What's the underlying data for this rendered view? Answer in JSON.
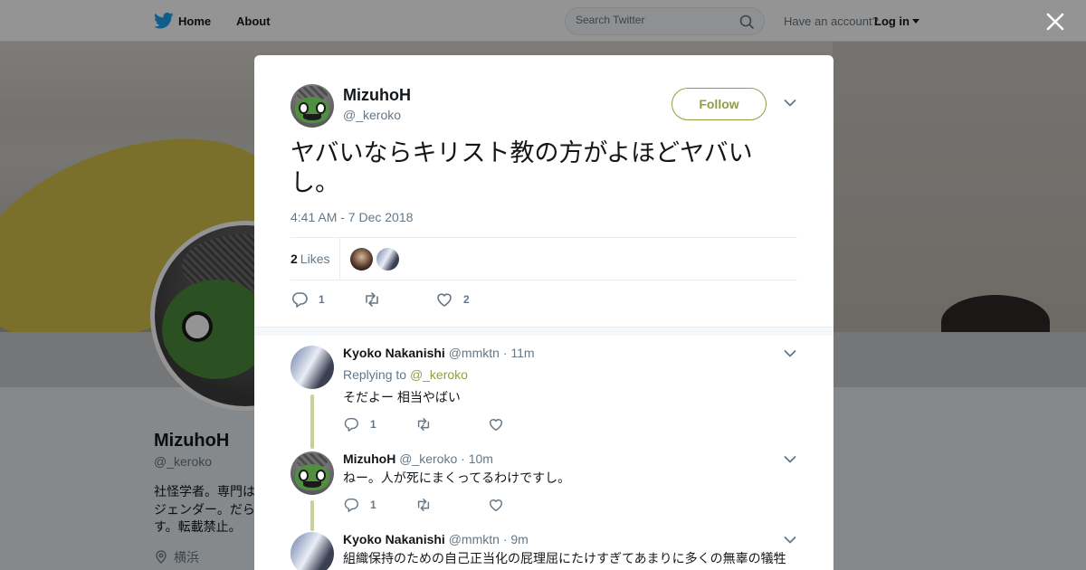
{
  "nav": {
    "home_label": "Home",
    "about_label": "About",
    "search_placeholder": "Search Twitter",
    "account_prompt": "Have an account?",
    "login_label": "Log in",
    "brand_color": "#1da1f2"
  },
  "profile": {
    "name": "MizuhoH",
    "handle": "@_keroko",
    "bio": "社怪学者。専門はジェンダー。だらす。転載禁止。",
    "location": "横浜"
  },
  "tweet": {
    "author_name": "MizuhoH",
    "author_handle": "@_keroko",
    "follow_label": "Follow",
    "text": "ヤバいならキリスト教の方がよほどヤバいし。",
    "timestamp": "4:41 AM - 7 Dec 2018",
    "likes_count": "2",
    "likes_label": "Likes",
    "reply_count": "1",
    "retweet_count": "",
    "like_count": "2",
    "accent_color": "#8ea041"
  },
  "replies": [
    {
      "name": "Kyoko Nakanishi",
      "handle": "@mmktn",
      "time": "· 11m",
      "replying_prefix": "Replying to",
      "replying_to": "@_keroko",
      "text": "そだよー 相当やばい",
      "reply_count": "1"
    },
    {
      "name": "MizuhoH",
      "handle": "@_keroko",
      "time": "· 10m",
      "text": "ねー。人が死にまくってるわけですし。",
      "reply_count": "1"
    },
    {
      "name": "Kyoko Nakanishi",
      "handle": "@mmktn",
      "time": "· 9m",
      "text": "組織保持のための自己正当化の屁理屈にたけすぎてあまりに多くの無辜の犠牲"
    }
  ],
  "icons": {
    "bird": "twitter-bird-icon",
    "search": "search-icon",
    "close": "close-icon",
    "chevron": "chevron-down-icon",
    "reply": "reply-icon",
    "retweet": "retweet-icon",
    "like": "heart-icon",
    "location": "location-pin-icon"
  }
}
